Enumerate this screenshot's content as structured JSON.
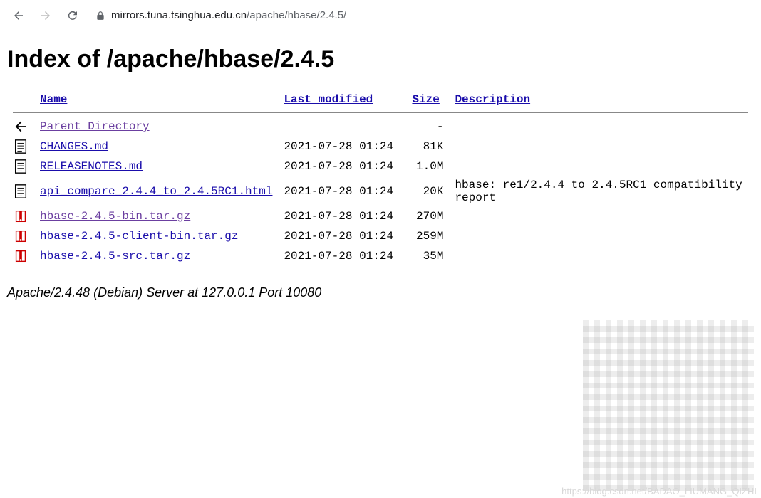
{
  "browser": {
    "url_host": "mirrors.tuna.tsinghua.edu.cn",
    "url_path": "/apache/hbase/2.4.5/"
  },
  "page": {
    "heading": "Index of /apache/hbase/2.4.5",
    "columns": {
      "name": "Name",
      "last_modified": "Last modified",
      "size": "Size",
      "description": "Description"
    },
    "rows": [
      {
        "icon": "back",
        "name": "Parent Directory",
        "last_modified": "",
        "size": "-",
        "description": "",
        "visited": true
      },
      {
        "icon": "text",
        "name": "CHANGES.md",
        "last_modified": "2021-07-28 01:24",
        "size": "81K",
        "description": "",
        "visited": false
      },
      {
        "icon": "text",
        "name": "RELEASENOTES.md",
        "last_modified": "2021-07-28 01:24",
        "size": "1.0M",
        "description": "",
        "visited": false
      },
      {
        "icon": "text",
        "name": "api_compare_2.4.4_to_2.4.5RC1.html",
        "last_modified": "2021-07-28 01:24",
        "size": "20K",
        "description": "hbase: re1/2.4.4 to 2.4.5RC1 compatibility report",
        "visited": false
      },
      {
        "icon": "compressed",
        "name": "hbase-2.4.5-bin.tar.gz",
        "last_modified": "2021-07-28 01:24",
        "size": "270M",
        "description": "",
        "visited": true
      },
      {
        "icon": "compressed",
        "name": "hbase-2.4.5-client-bin.tar.gz",
        "last_modified": "2021-07-28 01:24",
        "size": "259M",
        "description": "",
        "visited": false
      },
      {
        "icon": "compressed",
        "name": "hbase-2.4.5-src.tar.gz",
        "last_modified": "2021-07-28 01:24",
        "size": "35M",
        "description": "",
        "visited": false
      }
    ],
    "server_footer": "Apache/2.4.48 (Debian) Server at 127.0.0.1 Port 10080"
  },
  "watermark": "https://blog.csdn.net/BADAO_LIUMANG_QIZHI"
}
